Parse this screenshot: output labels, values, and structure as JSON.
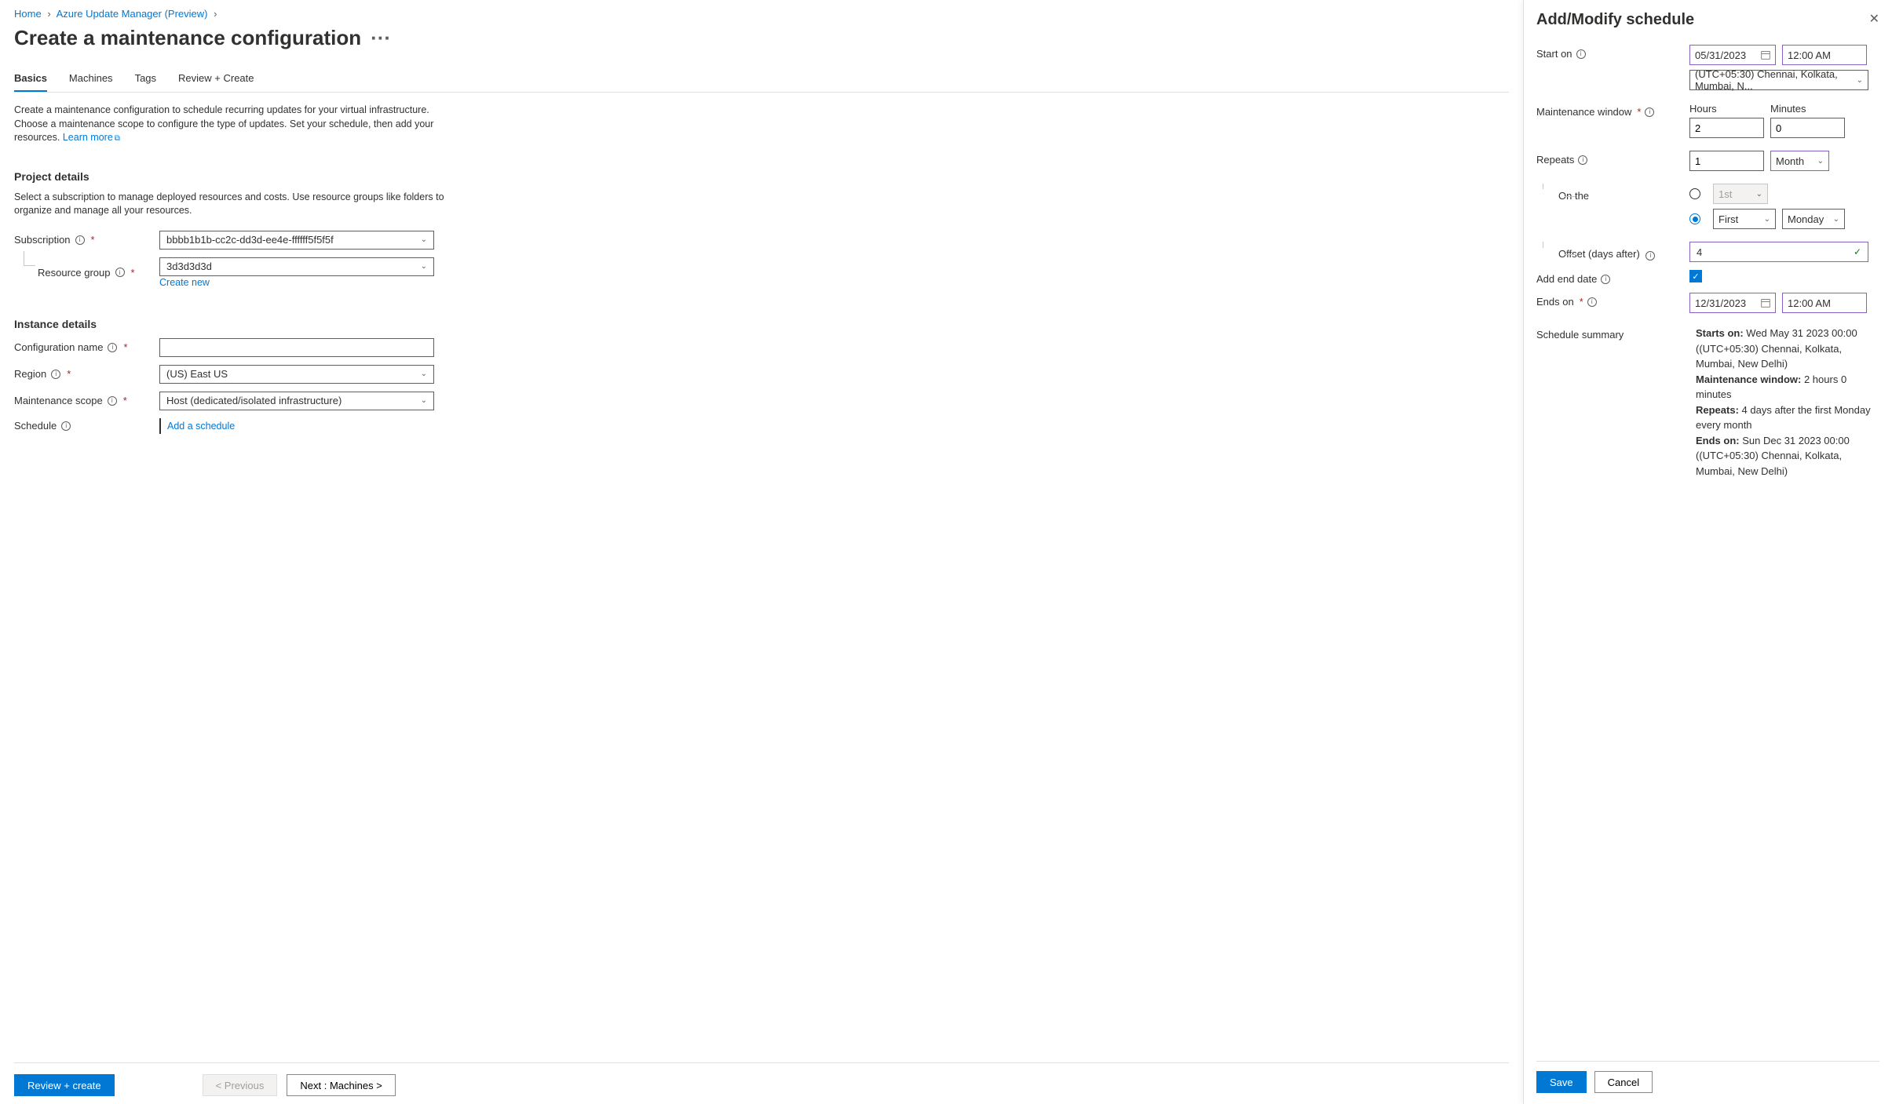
{
  "breadcrumb": {
    "home": "Home",
    "updateMgr": "Azure Update Manager (Preview)"
  },
  "pageTitle": "Create a maintenance configuration",
  "tabs": {
    "basics": "Basics",
    "machines": "Machines",
    "tags": "Tags",
    "review": "Review + Create"
  },
  "intro": "Create a maintenance configuration to schedule recurring updates for your virtual infrastructure. Choose a maintenance scope to configure the type of updates. Set your schedule, then add your resources.",
  "learnMore": "Learn more",
  "projectDetails": {
    "title": "Project details",
    "desc": "Select a subscription to manage deployed resources and costs. Use resource groups like folders to organize and manage all your resources.",
    "subscriptionLabel": "Subscription",
    "subscriptionValue": "bbbb1b1b-cc2c-dd3d-ee4e-ffffff5f5f5f",
    "resourceGroupLabel": "Resource group",
    "resourceGroupValue": "3d3d3d3d",
    "createNew": "Create new"
  },
  "instanceDetails": {
    "title": "Instance details",
    "configNameLabel": "Configuration name",
    "configNameValue": "",
    "regionLabel": "Region",
    "regionValue": "(US) East US",
    "scopeLabel": "Maintenance scope",
    "scopeValue": "Host (dedicated/isolated infrastructure)",
    "scheduleLabel": "Schedule",
    "addSchedule": "Add a schedule"
  },
  "footer": {
    "review": "Review + create",
    "previous": "< Previous",
    "next": "Next : Machines >"
  },
  "sidePanel": {
    "title": "Add/Modify schedule",
    "startOn": "Start on",
    "startDate": "05/31/2023",
    "startTime": "12:00 AM",
    "timezone": "(UTC+05:30) Chennai, Kolkata, Mumbai, N...",
    "maintWindow": "Maintenance window",
    "hoursLabel": "Hours",
    "hoursValue": "2",
    "minutesLabel": "Minutes",
    "minutesValue": "0",
    "repeats": "Repeats",
    "repeatNum": "1",
    "repeatUnit": "Month",
    "onThe": "On the",
    "firstDisabled": "1st",
    "ordinal": "First",
    "weekday": "Monday",
    "offsetLabel": "Offset (days after)",
    "offsetValue": "4",
    "addEndDate": "Add end date",
    "endsOn": "Ends on",
    "endDate": "12/31/2023",
    "endTime": "12:00 AM",
    "summaryLabel": "Schedule summary",
    "summary": {
      "startsOnLabel": "Starts on:",
      "startsOnValue": "Wed May 31 2023 00:00 ((UTC+05:30) Chennai, Kolkata, Mumbai, New Delhi)",
      "maintLabel": "Maintenance window:",
      "maintValue": "2 hours 0 minutes",
      "repeatsLabel": "Repeats:",
      "repeatsValue": "4 days after the first Monday every month",
      "endsOnLabel": "Ends on:",
      "endsOnValue": "Sun Dec 31 2023 00:00 ((UTC+05:30) Chennai, Kolkata, Mumbai, New Delhi)"
    },
    "save": "Save",
    "cancel": "Cancel"
  }
}
